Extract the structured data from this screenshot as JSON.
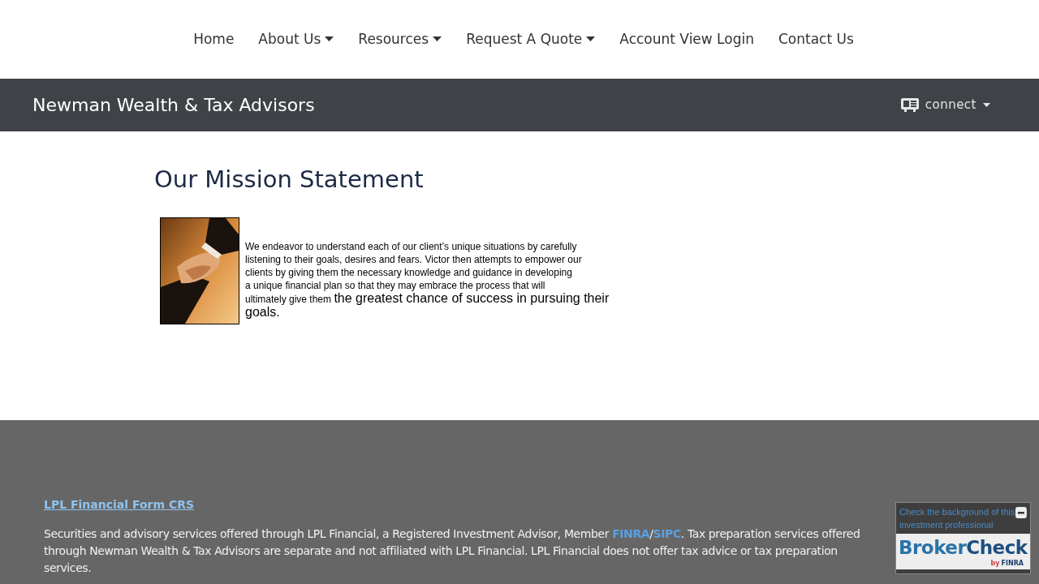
{
  "nav": [
    {
      "label": "Home",
      "dropdown": false
    },
    {
      "label": "About Us",
      "dropdown": true
    },
    {
      "label": "Resources",
      "dropdown": true
    },
    {
      "label": "Request A Quote",
      "dropdown": true
    },
    {
      "label": "Account View Login",
      "dropdown": false
    },
    {
      "label": "Contact Us",
      "dropdown": false
    }
  ],
  "header": {
    "title": "Newman Wealth & Tax Advisors",
    "connect": "connect"
  },
  "main": {
    "heading": "Our Mission Statement",
    "paragraph": {
      "lines": [
        "We endeavor to understand each of our client’s unique situations by carefully",
        "listening to their goals, desires and fears.  Victor then attempts to empower our",
        "clients by giving them the necessary knowledge and guidance in developing",
        "a unique financial plan so that they may embrace the process that will"
      ],
      "last_small": "ultimately give them",
      "last_large": "the greatest chance of success in pursuing their goals."
    }
  },
  "footer": {
    "form_link": "LPL Financial Form CRS",
    "disclosure": [
      {
        "kind": "text",
        "text": "Securities and advisory services offered through LPL Financial, a Registered Investment Advisor, Member "
      },
      {
        "kind": "link",
        "text": "FINRA"
      },
      {
        "kind": "text",
        "text": "/"
      },
      {
        "kind": "link",
        "text": "SIPC"
      },
      {
        "kind": "text",
        "text": ". Tax preparation services offered through Newman Wealth & Tax Advisors are separate and not affiliated with LPL Financial. LPL Financial does not offer tax advice or tax preparation services."
      }
    ]
  },
  "broker_check": {
    "caption": "Check the background of this investment professional",
    "logo_main": "Broker",
    "logo_check": "Check",
    "logo_by": "by",
    "logo_finra": "FINRA"
  }
}
